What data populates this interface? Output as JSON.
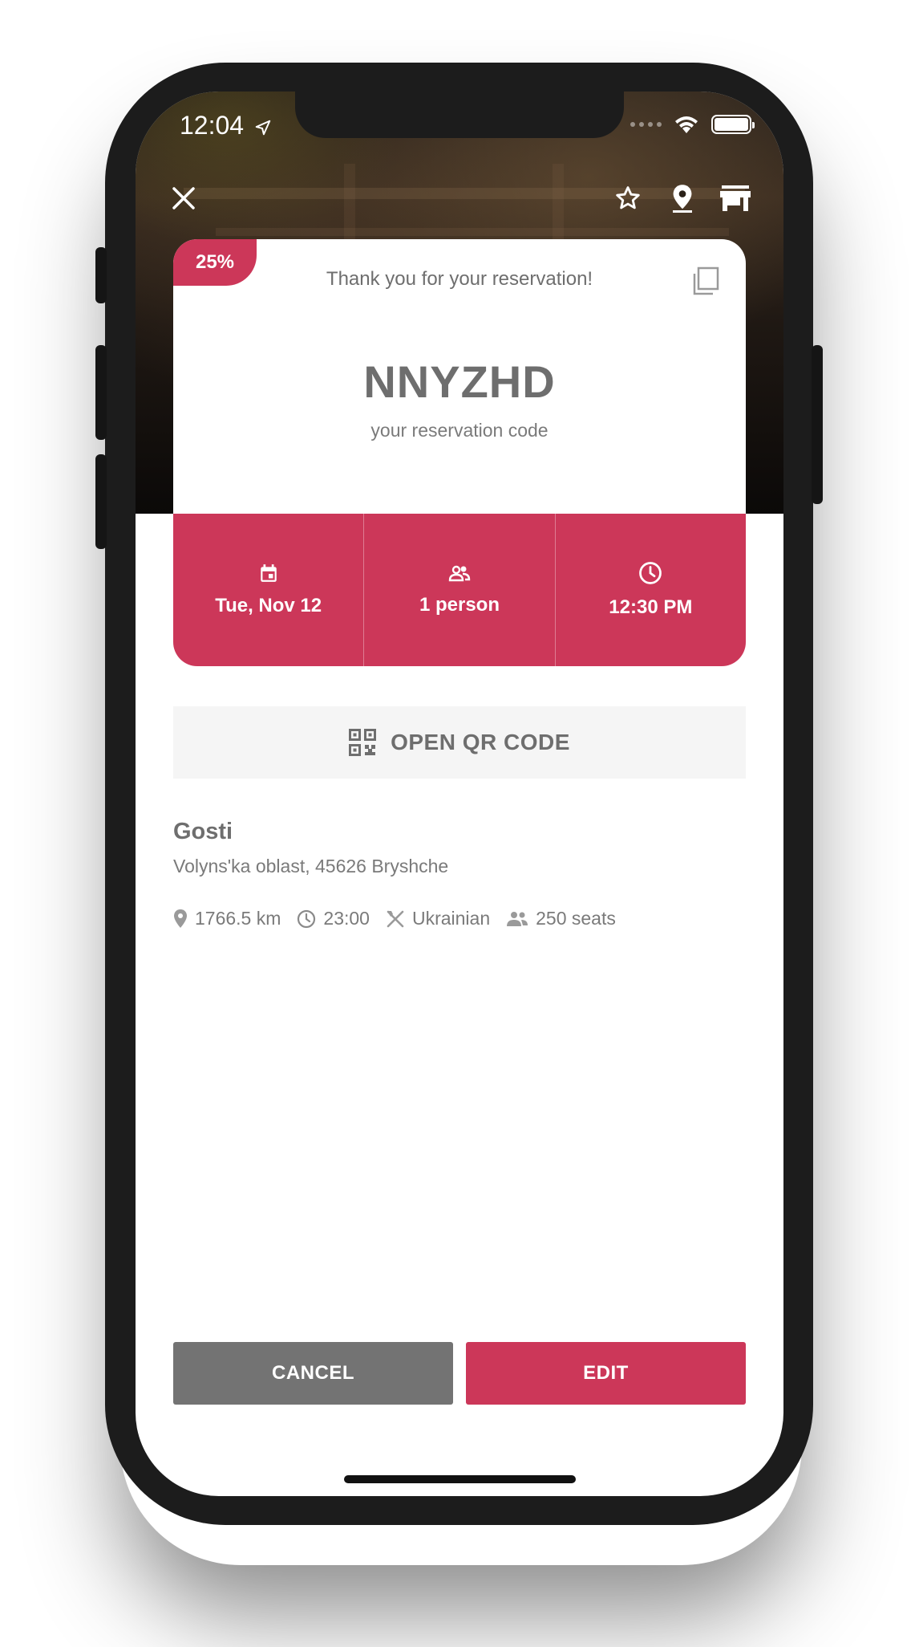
{
  "status": {
    "time": "12:04"
  },
  "colors": {
    "accent": "#cc3759",
    "cancel": "#737373",
    "text": "#6e6e6e"
  },
  "top_bar": {
    "icons": [
      "close-icon",
      "star-icon",
      "location-pin-icon",
      "store-icon"
    ]
  },
  "reservation": {
    "discount": "25%",
    "thank_you": "Thank you for your reservation!",
    "code": "NNYZHD",
    "code_caption": "your reservation code",
    "date": "Tue, Nov 12",
    "party": "1 person",
    "time": "12:30 PM"
  },
  "qr_button": {
    "label": "OPEN QR CODE"
  },
  "venue": {
    "name": "Gosti",
    "address": "Volyns'ka oblast, 45626 Bryshche",
    "distance": "1766.5 km",
    "hours": "23:00",
    "cuisine": "Ukrainian",
    "seats": "250 seats"
  },
  "actions": {
    "cancel_label": "CANCEL",
    "edit_label": "EDIT"
  }
}
